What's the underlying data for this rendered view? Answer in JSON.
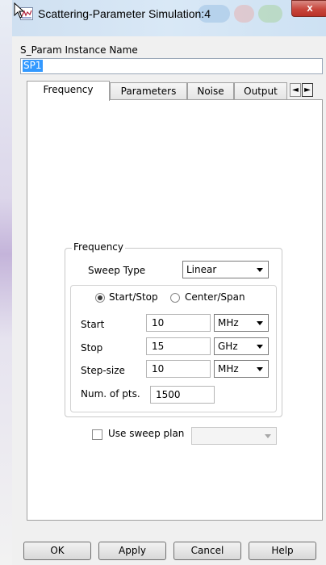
{
  "window": {
    "title": "Scattering-Parameter Simulation:4",
    "close_glyph": "x"
  },
  "instance": {
    "label": "S_Param Instance Name",
    "value": "SP1"
  },
  "tabs": [
    {
      "label": "Frequency",
      "active": true
    },
    {
      "label": "Parameters"
    },
    {
      "label": "Noise"
    },
    {
      "label": "Output"
    }
  ],
  "tab_scroll": {
    "left": "◄",
    "right": "►"
  },
  "frequency_group": {
    "title": "Frequency",
    "sweep_type_label": "Sweep Type",
    "sweep_type_value": "Linear",
    "radio_start_stop": "Start/Stop",
    "radio_center_span": "Center/Span",
    "rows": [
      {
        "label": "Start",
        "value": "10",
        "unit": "MHz"
      },
      {
        "label": "Stop",
        "value": "15",
        "unit": "GHz"
      },
      {
        "label": "Step-size",
        "value": "10",
        "unit": "MHz"
      }
    ],
    "num_pts_label": "Num. of pts.",
    "num_pts_value": "1500"
  },
  "sweep_plan": {
    "label": "Use sweep plan",
    "checked": false,
    "value": ""
  },
  "buttons": {
    "ok": "OK",
    "apply": "Apply",
    "cancel": "Cancel",
    "help": "Help"
  },
  "colors": {
    "selection": "#3399ff",
    "close_button": "#c8463c"
  }
}
